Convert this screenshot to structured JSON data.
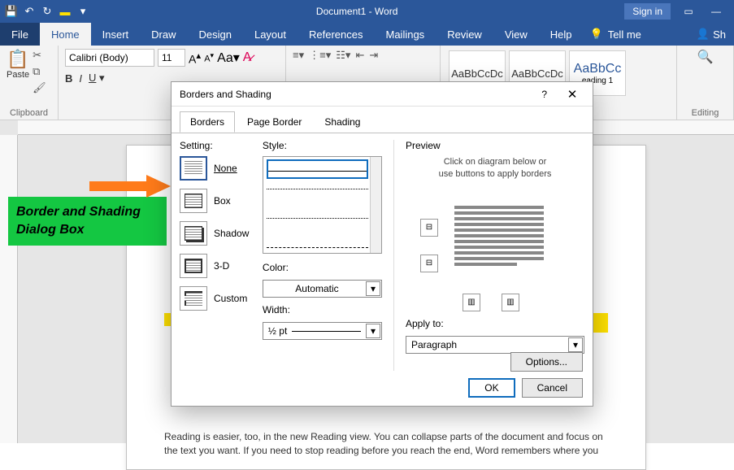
{
  "title": "Document1 - Word",
  "signin": "Sign in",
  "tabs": {
    "file": "File",
    "home": "Home",
    "insert": "Insert",
    "draw": "Draw",
    "design": "Design",
    "layout": "Layout",
    "references": "References",
    "mailings": "Mailings",
    "review": "Review",
    "view": "View",
    "help": "Help",
    "tellme": "Tell me",
    "share": "Sh"
  },
  "ribbon": {
    "paste": "Paste",
    "clipboard": "Clipboard",
    "font_name": "Calibri (Body)",
    "font_size": "11",
    "styles": {
      "normal": "AaBbCcDc",
      "nospace": "AaBbCcDc",
      "heading1": "AaBbCc",
      "h1label": "eading 1"
    },
    "editing": "Editing"
  },
  "dialog": {
    "title": "Borders and Shading",
    "tabs": {
      "borders": "Borders",
      "page": "Page Border",
      "shading": "Shading"
    },
    "setting_label": "Setting:",
    "settings": {
      "none": "None",
      "box": "Box",
      "shadow": "Shadow",
      "threed": "3-D",
      "custom": "Custom"
    },
    "style_label": "Style:",
    "color_label": "Color:",
    "color_value": "Automatic",
    "width_label": "Width:",
    "width_value": "½ pt",
    "preview_label": "Preview",
    "preview_hint1": "Click on diagram below or",
    "preview_hint2": "use buttons to apply borders",
    "apply_label": "Apply to:",
    "apply_value": "Paragraph",
    "options": "Options...",
    "ok": "OK",
    "cancel": "Cancel"
  },
  "callout": "Border and Shading Dialog Box",
  "doc_text": "Reading is easier, too, in the new Reading view. You can collapse parts of the document and focus on the text you want. If you need to stop reading before you reach the end, Word remembers where you"
}
